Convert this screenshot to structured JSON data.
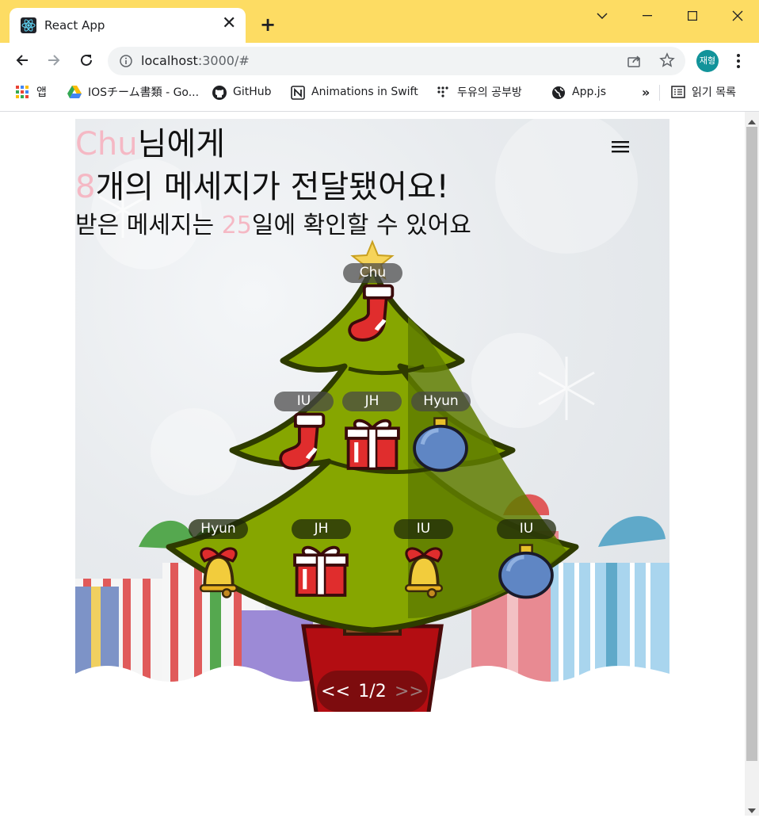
{
  "browser": {
    "tab_title": "React App",
    "url_host": "localhost",
    "url_path": ":3000/#",
    "profile_label": "재형",
    "bookmarks": [
      {
        "label": "앱",
        "icon": "apps-icon"
      },
      {
        "label": "IOSチーム書類 - Go...",
        "icon": "google-drive-icon"
      },
      {
        "label": "GitHub",
        "icon": "github-icon"
      },
      {
        "label": "Animations in Swift",
        "icon": "notion-icon"
      },
      {
        "label": "두유의 공부방",
        "icon": "dots-icon"
      },
      {
        "label": "App.js",
        "icon": "globe-icon"
      }
    ],
    "bookmarks_more": "»",
    "reading_list": "읽기 목록"
  },
  "page": {
    "recipient_name": "Chu",
    "recipient_suffix": "님에게",
    "message_count": "8",
    "message_count_suffix": "개의 메세지가 전달됐어요!",
    "days_prefix": "받은 메세지는 ",
    "days_value": "25",
    "days_suffix": "일에 확인할 수 있어요",
    "top_tag": "Chu",
    "ornaments_row1": [
      {
        "name": "IU",
        "type": "stocking"
      },
      {
        "name": "JH",
        "type": "gift"
      },
      {
        "name": "Hyun",
        "type": "bauble"
      }
    ],
    "ornaments_row2": [
      {
        "name": "Hyun",
        "type": "bell"
      },
      {
        "name": "JH",
        "type": "gift"
      },
      {
        "name": "IU",
        "type": "bell"
      },
      {
        "name": "IU",
        "type": "bauble"
      }
    ],
    "pager": {
      "prev": "<<",
      "page": "1/2",
      "next": ">>"
    }
  }
}
